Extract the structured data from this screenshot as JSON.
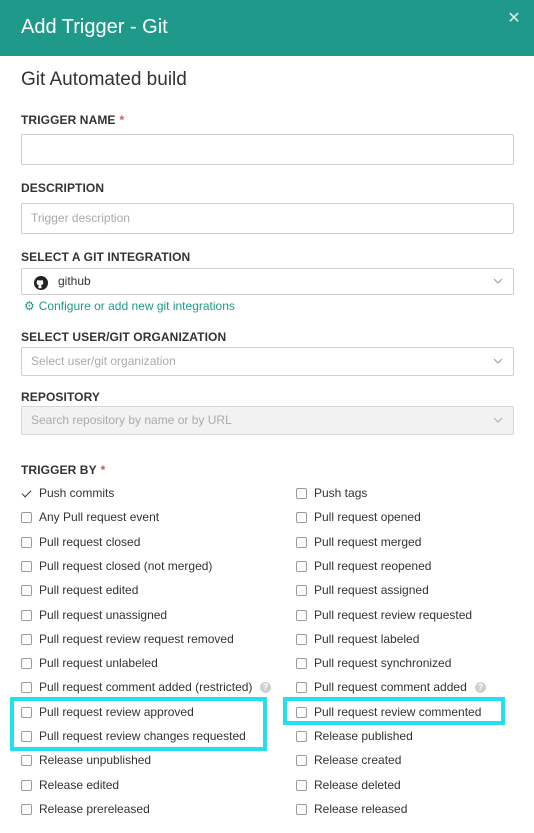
{
  "header": {
    "title": "Add Trigger - Git",
    "close_icon": "close-icon"
  },
  "section_title": "Git Automated build",
  "trigger_name": {
    "label": "TRIGGER NAME",
    "required_mark": "*",
    "value": ""
  },
  "description": {
    "label": "DESCRIPTION",
    "placeholder": "Trigger description"
  },
  "git_integration": {
    "label": "SELECT A GIT INTEGRATION",
    "selected": "github",
    "icon": "github-icon"
  },
  "config_link": {
    "icon": "gear-icon",
    "text": "Configure or add new git integrations"
  },
  "organization": {
    "label": "SELECT USER/GIT ORGANIZATION",
    "placeholder": "Select user/git organization"
  },
  "repository": {
    "label": "REPOSITORY",
    "placeholder": "Search repository by name or by URL"
  },
  "trigger_by": {
    "label": "TRIGGER BY",
    "required_mark": "*",
    "left": [
      {
        "label": "Push commits",
        "checked": true
      },
      {
        "label": "Any Pull request event",
        "checked": false
      },
      {
        "label": "Pull request closed",
        "checked": false
      },
      {
        "label": "Pull request closed (not merged)",
        "checked": false
      },
      {
        "label": "Pull request edited",
        "checked": false
      },
      {
        "label": "Pull request unassigned",
        "checked": false
      },
      {
        "label": "Pull request review request removed",
        "checked": false
      },
      {
        "label": "Pull request unlabeled",
        "checked": false
      },
      {
        "label": "Pull request comment added (restricted)",
        "checked": false,
        "help": "?"
      },
      {
        "label": "Pull request review approved",
        "checked": false
      },
      {
        "label": "Pull request review changes requested",
        "checked": false
      },
      {
        "label": "Release unpublished",
        "checked": false
      },
      {
        "label": "Release edited",
        "checked": false
      },
      {
        "label": "Release prereleased",
        "checked": false
      }
    ],
    "right": [
      {
        "label": "Push tags",
        "checked": false
      },
      {
        "label": "Pull request opened",
        "checked": false
      },
      {
        "label": "Pull request merged",
        "checked": false
      },
      {
        "label": "Pull request reopened",
        "checked": false
      },
      {
        "label": "Pull request assigned",
        "checked": false
      },
      {
        "label": "Pull request review requested",
        "checked": false
      },
      {
        "label": "Pull request labeled",
        "checked": false
      },
      {
        "label": "Pull request synchronized",
        "checked": false
      },
      {
        "label": "Pull request comment added",
        "checked": false,
        "help": "?"
      },
      {
        "label": "Pull request review commented",
        "checked": false
      },
      {
        "label": "Release published",
        "checked": false
      },
      {
        "label": "Release created",
        "checked": false
      },
      {
        "label": "Release deleted",
        "checked": false
      },
      {
        "label": "Release released",
        "checked": false
      }
    ]
  },
  "colors": {
    "header": "#1f9a8a",
    "link": "#1f9a8a",
    "required": "#e05050",
    "highlight": "#22e0ee"
  }
}
